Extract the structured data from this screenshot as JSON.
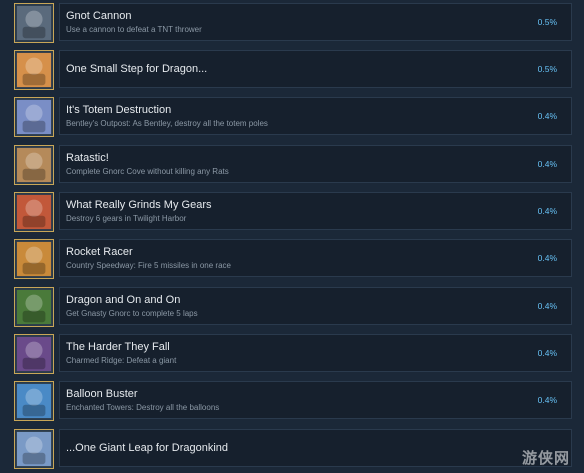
{
  "achievements": [
    {
      "title": "Gnot Cannon",
      "desc": "Use a cannon to defeat a TNT thrower",
      "pct": "0.5%",
      "icon": "gnorc-portrait-icon",
      "color": "#5a6a7c"
    },
    {
      "title": "One Small Step for Dragon...",
      "desc": "",
      "pct": "0.5%",
      "icon": "dragon-portrait-icon",
      "color": "#d6904a"
    },
    {
      "title": "It's Totem Destruction",
      "desc": "Bentley's Outpost: As Bentley, destroy all the totem poles",
      "pct": "0.4%",
      "icon": "totem-icon",
      "color": "#7a8ec6"
    },
    {
      "title": "Ratastic!",
      "desc": "Complete Gnorc Cove without killing any Rats",
      "pct": "0.4%",
      "icon": "rat-icon",
      "color": "#b58a5a"
    },
    {
      "title": "What Really Grinds My Gears",
      "desc": "Destroy 6 gears in Twilight Harbor",
      "pct": "0.4%",
      "icon": "gears-icon",
      "color": "#c2583a"
    },
    {
      "title": "Rocket Racer",
      "desc": "Country Speedway: Fire 5 missiles in one race",
      "pct": "0.4%",
      "icon": "speedway-icon",
      "color": "#c98a3a"
    },
    {
      "title": "Dragon and On and On",
      "desc": "Get Gnasty Gnorc to complete 5 laps",
      "pct": "0.4%",
      "icon": "gnasty-gnorc-icon",
      "color": "#4a7a3a"
    },
    {
      "title": "The Harder They Fall",
      "desc": "Charmed Ridge: Defeat a giant",
      "pct": "0.4%",
      "icon": "giant-icon",
      "color": "#6a4a8a"
    },
    {
      "title": "Balloon Buster",
      "desc": "Enchanted Towers: Destroy all the balloons",
      "pct": "0.4%",
      "icon": "balloon-icon",
      "color": "#4a8ac6"
    },
    {
      "title": "...One Giant Leap for Dragonkind",
      "desc": "",
      "pct": "",
      "icon": "dragon-leap-icon",
      "color": "#7a9ac6"
    }
  ],
  "watermark": "游侠网"
}
